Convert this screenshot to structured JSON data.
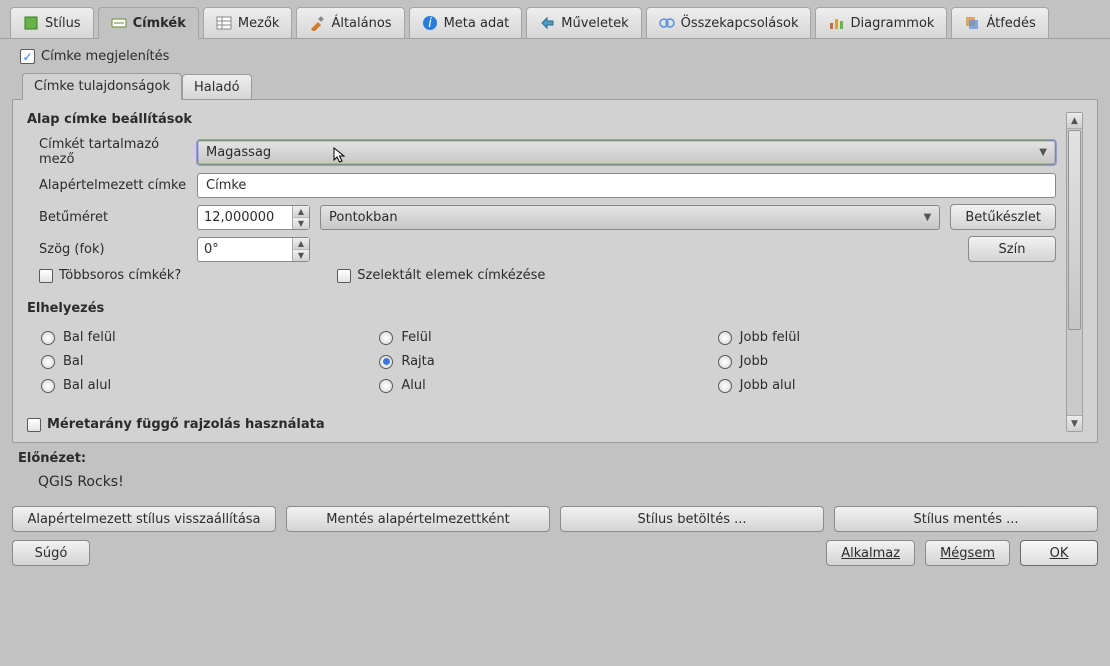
{
  "outer_tabs": [
    {
      "id": "stilus",
      "label": "Stílus"
    },
    {
      "id": "cimkek",
      "label": "Címkék"
    },
    {
      "id": "mezok",
      "label": "Mezők"
    },
    {
      "id": "altalanos",
      "label": "Általános"
    },
    {
      "id": "meta",
      "label": "Meta adat"
    },
    {
      "id": "muveletek",
      "label": "Műveletek"
    },
    {
      "id": "osszekapcs",
      "label": "Összekapcsolások"
    },
    {
      "id": "diagrammok",
      "label": "Diagrammok"
    },
    {
      "id": "atfedes",
      "label": "Átfedés"
    }
  ],
  "outer_active": "cimkek",
  "display_labels": {
    "label": "Címke megjelenítés",
    "checked": true
  },
  "inner_tabs": [
    {
      "id": "tulajdonsagok",
      "label": "Címke tulajdonságok"
    },
    {
      "id": "halado",
      "label": "Haladó"
    }
  ],
  "inner_active": "tulajdonsagok",
  "section_title": "Alap címke beállítások",
  "field_containing": {
    "label": "Címkét tartalmazó mező",
    "value": "Magassag"
  },
  "default_label": {
    "label": "Alapértelmezett címke",
    "value": "Címke"
  },
  "font_size": {
    "label": "Betűméret",
    "value": "12,000000",
    "unit": "Pontokban",
    "button": "Betűkészlet"
  },
  "angle": {
    "label": "Szög (fok)",
    "value": "0°",
    "color_button": "Szín"
  },
  "multiline": {
    "label": "Többsoros címkék?",
    "checked": false
  },
  "label_selected": {
    "label": "Szelektált elemek címkézése",
    "checked": false
  },
  "placement": {
    "title": "Elhelyezés",
    "options": [
      {
        "id": "tl",
        "label": "Bal felül"
      },
      {
        "id": "t",
        "label": "Felül"
      },
      {
        "id": "tr",
        "label": "Jobb felül"
      },
      {
        "id": "l",
        "label": "Bal"
      },
      {
        "id": "on",
        "label": "Rajta"
      },
      {
        "id": "r",
        "label": "Jobb"
      },
      {
        "id": "bl",
        "label": "Bal alul"
      },
      {
        "id": "b",
        "label": "Alul"
      },
      {
        "id": "br",
        "label": "Jobb alul"
      }
    ],
    "selected": "on"
  },
  "scale_dependent": {
    "label": "Méretarány függő rajzolás használata",
    "checked": false
  },
  "preview": {
    "label": "Előnézet:",
    "value": "QGIS Rocks!"
  },
  "footer": {
    "restore": "Alapértelmezett stílus visszaállítása",
    "save_default": "Mentés alapértelmezettként",
    "load_style": "Stílus betöltés ...",
    "save_style": "Stílus mentés ...",
    "help": "Súgó",
    "apply": "Alkalmaz",
    "cancel": "Mégsem",
    "ok": "OK"
  },
  "icons": {
    "stilus_color": "#6ab34a",
    "mezok_color": "#5c80b0",
    "alt_color": "#d97a2a",
    "meta_color": "#2a7ed9",
    "muv_color": "#4aa0c8",
    "ossze_color": "#5a8fdd",
    "diag_color": "#c86a4a",
    "atf_color": "#d99a2a"
  }
}
